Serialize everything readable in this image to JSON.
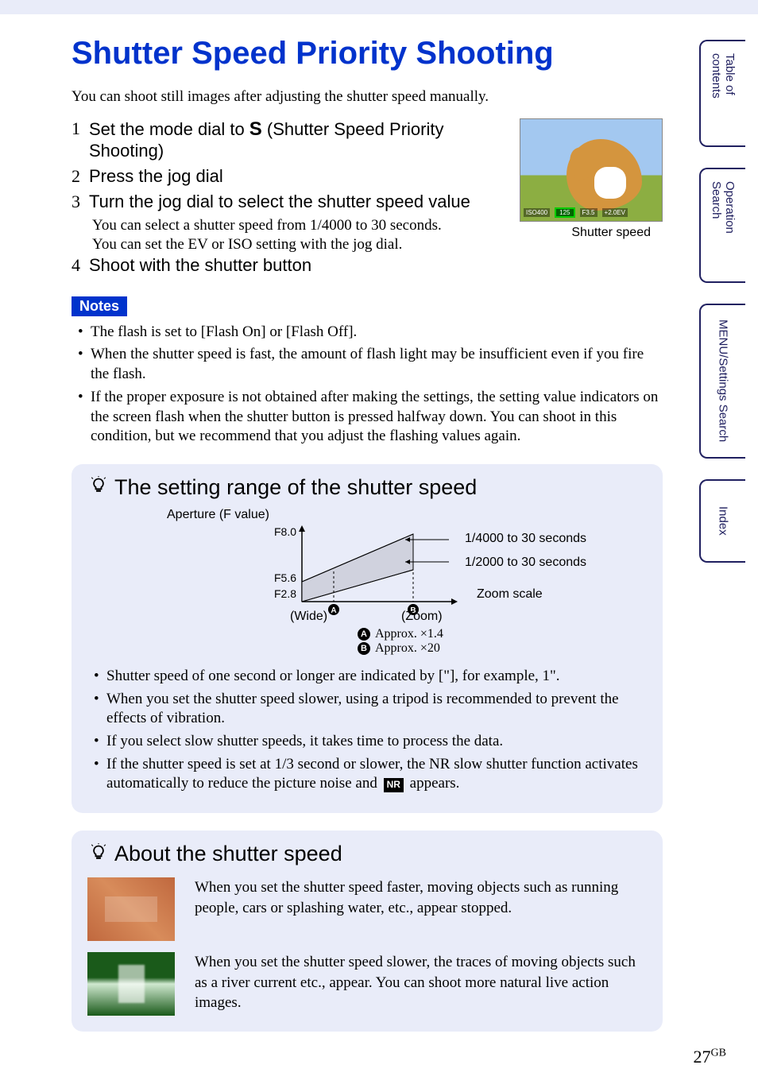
{
  "title": "Shutter Speed Priority Shooting",
  "intro": "You can shoot still images after adjusting the shutter speed manually.",
  "steps": {
    "s1": {
      "num": "1",
      "pre": "Set the mode dial to ",
      "icon": "S",
      "post": " (Shutter Speed Priority Shooting)"
    },
    "s2": {
      "num": "2",
      "text": "Press the jog dial"
    },
    "s3": {
      "num": "3",
      "text": "Turn the jog dial to select the shutter speed value",
      "sub1": "You can select a shutter speed from 1/4000 to 30 seconds.",
      "sub2": "You can set the EV or ISO setting with the jog dial."
    },
    "s4": {
      "num": "4",
      "text": "Shoot with the shutter button"
    }
  },
  "photo": {
    "status": {
      "iso": "ISO400",
      "shutter": "125",
      "f": "F3.5",
      "ev": "+2.0EV"
    },
    "caption": "Shutter speed"
  },
  "notes": {
    "tag": "Notes",
    "items": [
      "The flash is set to [Flash On] or [Flash Off].",
      "When the shutter speed is fast, the amount of flash light may be insufficient even if you fire the flash.",
      "If the proper exposure is not obtained after making the settings, the setting value indicators on the screen flash when the shutter button is pressed halfway down. You can shoot in this condition, but we recommend that you adjust the flashing values again."
    ]
  },
  "tip1": {
    "heading": "The setting range of the shutter speed",
    "chart": {
      "ylabel": "Aperture (F value)",
      "yticks": [
        "F8.0",
        "F5.6",
        "F2.8"
      ],
      "xwide": "(Wide)",
      "xzoom": "(Zoom)",
      "r1": "1/4000 to 30 seconds",
      "r2": "1/2000 to 30 seconds",
      "r3": "Zoom scale",
      "legendA": "Approx. ×1.4",
      "legendB": "Approx. ×20"
    },
    "bullets": [
      "Shutter speed of one second or longer are indicated by [\"], for example, 1\".",
      "When you set the shutter speed slower, using a tripod is recommended to prevent the effects of vibration.",
      "If you select slow shutter speeds, it takes time to process the data.",
      "If the shutter speed is set at 1/3 second or slower, the NR slow shutter function activates automatically to reduce the picture noise and           appears."
    ],
    "bullet4_pre": "If the shutter speed is set at 1/3 second or slower, the NR slow shutter function activates automatically to reduce the picture noise and ",
    "bullet4_badge": "NR",
    "bullet4_post": " appears."
  },
  "tip2": {
    "heading": "About the shutter speed",
    "row1": "When you set the shutter speed faster, moving objects such as running people, cars or splashing water, etc., appear stopped.",
    "row2": "When you set the shutter speed slower, the traces of moving objects such as a river current etc., appear. You can shoot more natural live action images."
  },
  "tabs": {
    "t1": "Table of contents",
    "t2": "Operation Search",
    "t3": "MENU/Settings Search",
    "t4": "Index"
  },
  "page": {
    "num": "27",
    "suffix": "GB"
  },
  "chart_data": {
    "type": "area",
    "title": "The setting range of the shutter speed",
    "xlabel": "Zoom scale",
    "ylabel": "Aperture (F value)",
    "x_markers": [
      {
        "id": "A",
        "label": "Approx. ×1.4",
        "position": "wide-side"
      },
      {
        "id": "B",
        "label": "Approx. ×20",
        "position": "zoom-side"
      }
    ],
    "y_ticks": [
      2.8,
      5.6,
      8.0
    ],
    "regions": [
      {
        "name": "upper",
        "range_label": "1/4000 to 30 seconds",
        "approx_f_range": [
          5.6,
          8.0
        ]
      },
      {
        "name": "lower",
        "range_label": "1/2000 to 30 seconds",
        "approx_f_range": [
          2.8,
          5.6
        ]
      }
    ],
    "x_axis_endpoints": [
      "(Wide)",
      "(Zoom)"
    ]
  }
}
